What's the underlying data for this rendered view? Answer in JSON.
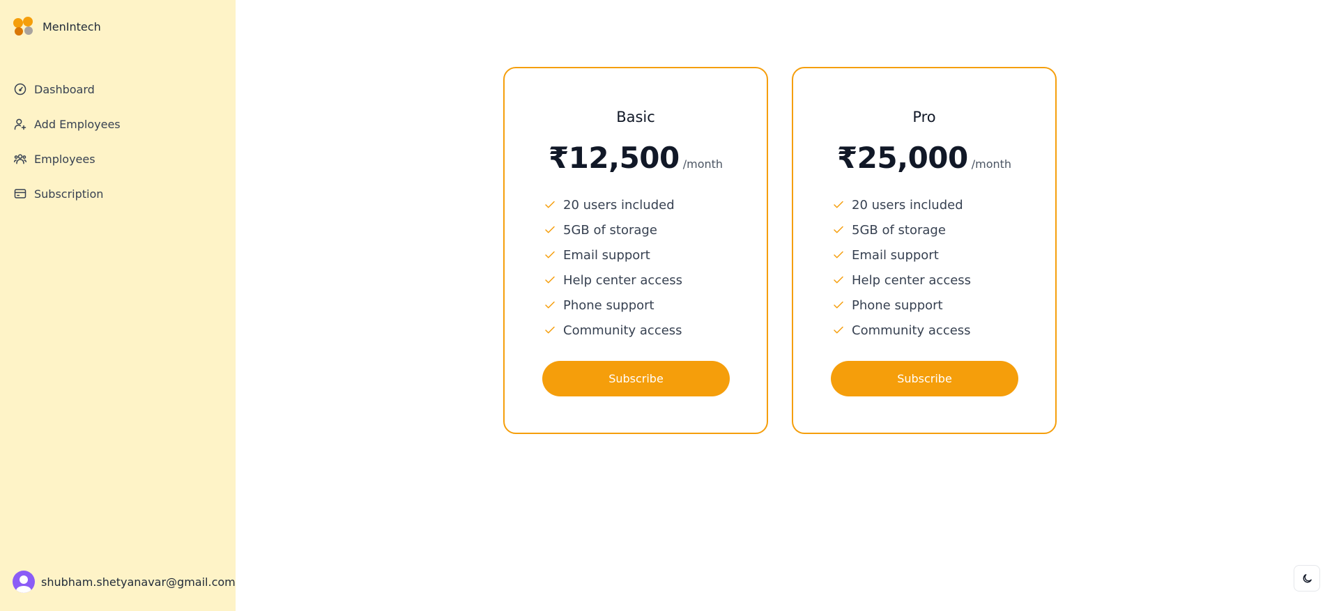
{
  "brand": {
    "name": "MenIntech"
  },
  "sidebar": {
    "items": [
      {
        "label": "Dashboard",
        "icon": "gauge-icon"
      },
      {
        "label": "Add Employees",
        "icon": "user-plus-icon"
      },
      {
        "label": "Employees",
        "icon": "users-icon"
      },
      {
        "label": "Subscription",
        "icon": "credit-card-icon"
      }
    ]
  },
  "account": {
    "email": "shubham.shetyanavar@gmail.com"
  },
  "plans": [
    {
      "name": "Basic",
      "price": "₹12,500",
      "period": "/month",
      "features": [
        "20 users included",
        "5GB of storage",
        "Email support",
        "Help center access",
        "Phone support",
        "Community access"
      ],
      "button": "Subscribe"
    },
    {
      "name": "Pro",
      "price": "₹25,000",
      "period": "/month",
      "features": [
        "20 users included",
        "5GB of storage",
        "Email support",
        "Help center access",
        "Phone support",
        "Community access"
      ],
      "button": "Subscribe"
    }
  ],
  "theme_toggle": {
    "icon": "moon-icon"
  },
  "colors": {
    "sidebar_bg": "#fef3c7",
    "accent": "#f59e0b",
    "avatar": "#8b5cf6"
  }
}
